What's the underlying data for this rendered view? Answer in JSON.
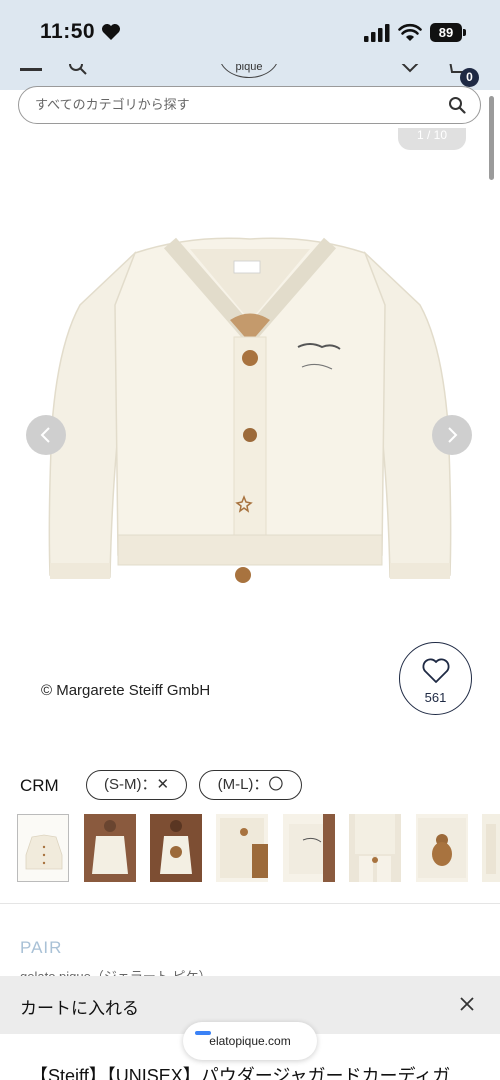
{
  "status_bar": {
    "time": "11:50",
    "battery": "89"
  },
  "header": {
    "logo_text": "pique",
    "cart_count": "0"
  },
  "search": {
    "placeholder": "すべてのカテゴリから探す"
  },
  "gallery": {
    "counter": "1 / 10"
  },
  "product": {
    "copyright": "© Margarete Steiff GmbH",
    "favorite_count": "561",
    "color_label": "CRM",
    "sizes": [
      {
        "label": "(S-M)：✕"
      },
      {
        "label": "(M-L)：〇"
      }
    ],
    "thumbnail_count": 8,
    "title": "【Steiff】【UNISEX】パウダージャガードカーディガ"
  },
  "pair_section": {
    "heading": "PAIR",
    "subtitle": "gelato pique（ジェラート ピケ）"
  },
  "cart_bar": {
    "label": "カートに入れる"
  },
  "browser": {
    "url": "elatopique.com"
  },
  "colors": {
    "status_bg": "#dde7f0",
    "navy": "#1f2a44",
    "pair_heading": "#a9c1d6",
    "cart_bar_bg": "#ececec"
  }
}
